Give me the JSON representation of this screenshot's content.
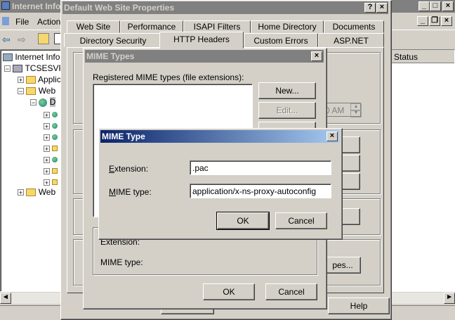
{
  "iis": {
    "title": "Internet Info",
    "menu": [
      "File",
      "Action"
    ],
    "tree": [
      "Internet Info",
      "TCSESVR",
      "Applic",
      "Web",
      "D",
      "Web"
    ],
    "column_status": "Status"
  },
  "props": {
    "title": "Default Web Site Properties",
    "tabs_row1": [
      "Web Site",
      "Performance",
      "ISAPI Filters",
      "Home Directory",
      "Documents"
    ],
    "tabs_row2": [
      "Directory Security",
      "HTTP Headers",
      "Custom Errors",
      "ASP.NET"
    ],
    "time_fragment": "0 AM",
    "file_types_btn": "pes...",
    "help_btn": "Help"
  },
  "mime_types": {
    "title": "MIME Types",
    "registered_label": "Registered MIME types (file extensions):",
    "new_btn": "New...",
    "edit_btn": "Edit...",
    "extension_label": "Extension:",
    "mime_type_label": "MIME type:",
    "ok_btn": "OK",
    "cancel_btn": "Cancel"
  },
  "mime_type": {
    "title": "MIME Type",
    "extension_label": "Extension:",
    "extension_value": ".pac",
    "mime_type_label": "MIME type:",
    "mime_type_value": "application/x-ns-proxy-autoconfig",
    "ok_btn": "OK",
    "cancel_btn": "Cancel"
  }
}
